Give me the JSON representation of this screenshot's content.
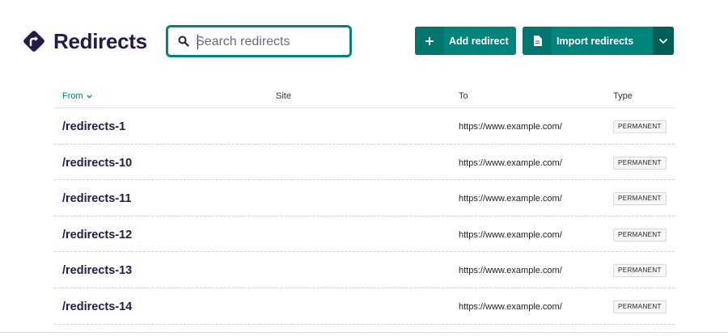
{
  "header": {
    "title": "Redirects",
    "logo_icon": "redirect-sign-icon"
  },
  "search": {
    "placeholder": "Search redirects",
    "value": ""
  },
  "toolbar": {
    "add_label": "Add redirect",
    "add_icon": "plus-icon",
    "import_label": "Import redirects",
    "import_icon": "document-icon",
    "more_icon": "chevron-down-icon"
  },
  "table": {
    "columns": {
      "from": "From",
      "site": "Site",
      "to": "To",
      "type": "Type"
    },
    "sort_icon": "chevron-down-icon",
    "rows": [
      {
        "from": "/redirects-1",
        "site": "",
        "to": "https://www.example.com/",
        "type": "PERMANENT"
      },
      {
        "from": "/redirects-10",
        "site": "",
        "to": "https://www.example.com/",
        "type": "PERMANENT"
      },
      {
        "from": "/redirects-11",
        "site": "",
        "to": "https://www.example.com/",
        "type": "PERMANENT"
      },
      {
        "from": "/redirects-12",
        "site": "",
        "to": "https://www.example.com/",
        "type": "PERMANENT"
      },
      {
        "from": "/redirects-13",
        "site": "",
        "to": "https://www.example.com/",
        "type": "PERMANENT"
      },
      {
        "from": "/redirects-14",
        "site": "",
        "to": "https://www.example.com/",
        "type": "PERMANENT"
      }
    ]
  },
  "colors": {
    "accent": "#00847b",
    "text_dark": "#261a4a"
  }
}
